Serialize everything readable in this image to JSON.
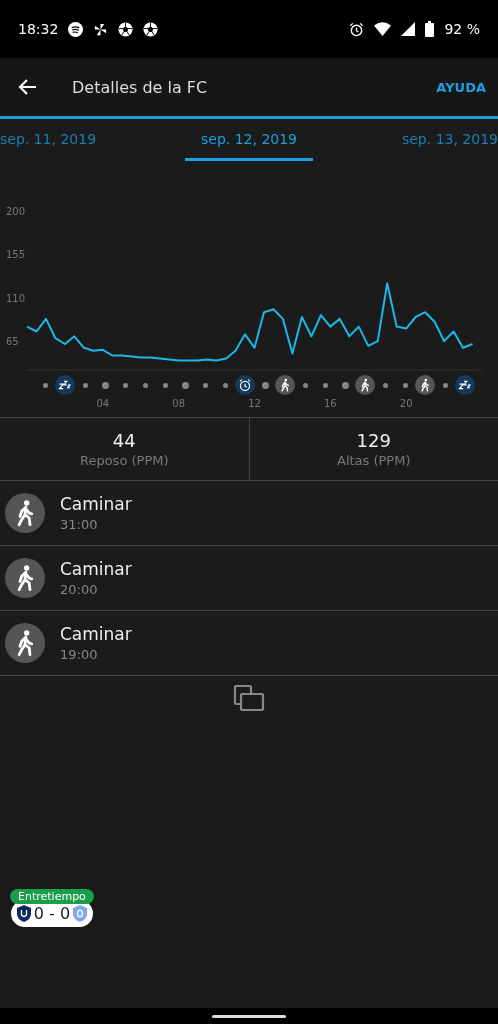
{
  "status_bar": {
    "time": "18:32",
    "battery": "92 %"
  },
  "app_bar": {
    "title": "Detalles de la FC",
    "action": "AYUDA"
  },
  "date_tabs": [
    {
      "label": "sep. 11, 2019",
      "selected": false
    },
    {
      "label": "sep. 12, 2019",
      "selected": true
    },
    {
      "label": "sep. 13, 2019",
      "selected": false
    }
  ],
  "chart": {
    "chart_data": {
      "type": "line",
      "x": [
        0,
        0.5,
        1,
        1.5,
        2,
        2.5,
        3,
        3.5,
        4,
        4.5,
        5,
        5.5,
        6,
        6.5,
        7,
        7.5,
        8,
        8.5,
        9,
        9.5,
        10,
        10.5,
        11,
        11.5,
        12,
        12.5,
        13,
        13.5,
        14,
        14.5,
        15,
        15.5,
        16,
        16.5,
        17,
        17.5,
        18,
        18.5,
        19,
        19.5,
        20,
        20.5,
        21,
        21.5,
        22,
        22.5,
        23,
        23.5
      ],
      "series": [
        {
          "color": "#1ab8e8",
          "values": [
            80,
            75,
            88,
            68,
            62,
            70,
            58,
            55,
            56,
            50,
            50,
            49,
            48,
            48,
            47,
            46,
            45,
            45,
            45,
            46,
            45,
            47,
            55,
            72,
            58,
            95,
            98,
            88,
            52,
            90,
            70,
            92,
            80,
            88,
            70,
            80,
            60,
            65,
            125,
            80,
            78,
            90,
            95,
            85,
            65,
            75,
            58,
            62
          ]
        }
      ],
      "xlim": [
        0,
        24
      ],
      "ylim": [
        35,
        200
      ],
      "xticks": [
        {
          "value": 4,
          "label": "04"
        },
        {
          "value": 8,
          "label": "08"
        },
        {
          "value": 12,
          "label": "12"
        },
        {
          "value": 16,
          "label": "16"
        },
        {
          "value": 20,
          "label": "20"
        }
      ],
      "yticks": [
        65,
        110,
        155,
        200
      ]
    },
    "markers": [
      {
        "kind": "dot"
      },
      {
        "kind": "sleep"
      },
      {
        "kind": "dot"
      },
      {
        "kind": "major"
      },
      {
        "kind": "dot"
      },
      {
        "kind": "dot"
      },
      {
        "kind": "dot"
      },
      {
        "kind": "major"
      },
      {
        "kind": "dot"
      },
      {
        "kind": "dot"
      },
      {
        "kind": "alarm"
      },
      {
        "kind": "major"
      },
      {
        "kind": "walk"
      },
      {
        "kind": "dot"
      },
      {
        "kind": "dot"
      },
      {
        "kind": "major"
      },
      {
        "kind": "walk"
      },
      {
        "kind": "dot"
      },
      {
        "kind": "dot"
      },
      {
        "kind": "walk"
      },
      {
        "kind": "dot"
      },
      {
        "kind": "sleep"
      }
    ]
  },
  "stats": [
    {
      "value": "44",
      "label": "Reposo (PPM)"
    },
    {
      "value": "129",
      "label": "Altas (PPM)"
    }
  ],
  "activities": [
    {
      "name": "Caminar",
      "duration": "31:00"
    },
    {
      "name": "Caminar",
      "duration": "20:00"
    },
    {
      "name": "Caminar",
      "duration": "19:00"
    }
  ],
  "score_widget": {
    "badge": "Entretiempo",
    "score": "0 - 0"
  }
}
